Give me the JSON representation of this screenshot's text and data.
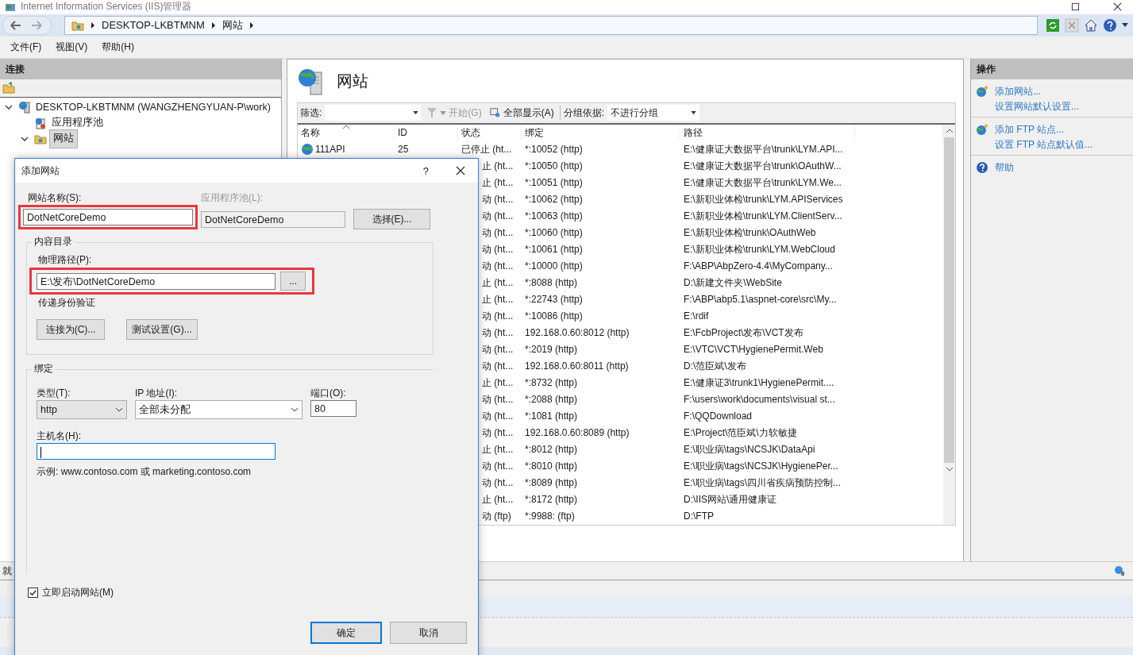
{
  "window": {
    "title": "Internet Information Services (IIS)管理器"
  },
  "address": {
    "crumbs": [
      "DESKTOP-LKBTMNM",
      "网站"
    ]
  },
  "menu": [
    "文件(F)",
    "视图(V)",
    "帮助(H)"
  ],
  "connections": {
    "title": "连接",
    "tree": [
      {
        "label": "DESKTOP-LKBTMNM (WANGZHENGYUAN-P\\work)",
        "kind": "server",
        "expanded": true,
        "selected": false,
        "children": [
          {
            "label": "应用程序池",
            "kind": "pool",
            "selected": false
          },
          {
            "label": "网站",
            "kind": "sites",
            "expanded": true,
            "selected": true
          }
        ]
      }
    ]
  },
  "content": {
    "title": "网站",
    "filter": {
      "label": "筛选:"
    },
    "start": {
      "label": "开始(G)",
      "disabled": true
    },
    "show_all": "全部显示(A)",
    "group_by": {
      "label": "分组依据:",
      "value": "不进行分组"
    },
    "columns": [
      "名称",
      "ID",
      "状态",
      "绑定",
      "路径"
    ],
    "rows": [
      {
        "name": "111API",
        "id": "25",
        "status": "已停止 (ht...",
        "binding": "*:10052 (http)",
        "path": "E:\\健康证大数据平台\\trunk\\LYM.API..."
      },
      {
        "status": "止 (ht...",
        "binding": "*:10050 (http)",
        "path": "E:\\健康证大数据平台\\trunk\\OAuthW..."
      },
      {
        "status": "止 (ht...",
        "binding": "*:10051 (http)",
        "path": "E:\\健康证大数据平台\\trunk\\LYM.We..."
      },
      {
        "status": "动 (ht...",
        "binding": "*:10062 (http)",
        "path": "E:\\新职业体检\\trunk\\LYM.APIServices"
      },
      {
        "status": "动 (ht...",
        "binding": "*:10063 (http)",
        "path": "E:\\新职业体检\\trunk\\LYM.ClientServ..."
      },
      {
        "status": "动 (ht...",
        "binding": "*:10060 (http)",
        "path": "E:\\新职业体检\\trunk\\OAuthWeb"
      },
      {
        "status": "动 (ht...",
        "binding": "*:10061 (http)",
        "path": "E:\\新职业体检\\trunk\\LYM.WebCloud"
      },
      {
        "status": "动 (ht...",
        "binding": "*:10000 (http)",
        "path": "F:\\ABP\\AbpZero-4.4\\MyCompany..."
      },
      {
        "status": "止 (ht...",
        "binding": "*:8088 (http)",
        "path": "D:\\新建文件夹\\WebSite"
      },
      {
        "status": "止 (ht...",
        "binding": "*:22743 (http)",
        "path": "F:\\ABP\\abp5.1\\aspnet-core\\src\\My..."
      },
      {
        "status": "动 (ht...",
        "binding": "*:10086 (http)",
        "path": "E:\\rdif"
      },
      {
        "status": "动 (ht...",
        "binding": "192.168.0.60:8012 (http)",
        "path": "E:\\FcbProject\\发布\\VCT发布"
      },
      {
        "status": "动 (ht...",
        "binding": "*:2019 (http)",
        "path": "E:\\VTC\\VCT\\HygienePermit.Web"
      },
      {
        "status": "动 (ht...",
        "binding": "192.168.0.60:8011 (http)",
        "path": "D:\\范臣斌\\发布"
      },
      {
        "status": "止 (ht...",
        "binding": "*:8732 (http)",
        "path": "E:\\健康证3\\trunk1\\HygienePermit...."
      },
      {
        "status": "动 (ht...",
        "binding": "*:2088 (http)",
        "path": "F:\\users\\work\\documents\\visual st..."
      },
      {
        "status": "动 (ht...",
        "binding": "*:1081 (http)",
        "path": "F:\\QQDownload"
      },
      {
        "status": "动 (ht...",
        "binding": "192.168.0.60:8089 (http)",
        "path": "E:\\Project\\范臣斌\\力软敏捷"
      },
      {
        "status": "止 (ht...",
        "binding": "*:8012 (http)",
        "path": "E:\\职业病\\tags\\NCSJK\\DataApi"
      },
      {
        "status": "动 (ht...",
        "binding": "*:8010 (http)",
        "path": "E:\\职业病\\tags\\NCSJK\\HygienePer..."
      },
      {
        "status": "动 (ht...",
        "binding": "*:8089 (http)",
        "path": "E:\\职业病\\tags\\四川省疾病预防控制..."
      },
      {
        "status": "止 (ht...",
        "binding": "*:8172 (http)",
        "path": "D:\\IIS网站\\通用健康证"
      },
      {
        "status": "动 (ftp)",
        "binding": "*:9988: (ftp)",
        "path": "D:\\FTP"
      }
    ]
  },
  "actions": {
    "title": "操作",
    "groups": [
      [
        {
          "label": "添加网站...",
          "kind": "add"
        },
        {
          "label": "设置网站默认设置...",
          "kind": "plain"
        }
      ],
      [
        {
          "label": "添加 FTP 站点...",
          "kind": "add"
        },
        {
          "label": "设置 FTP 站点默认值...",
          "kind": "plain"
        }
      ],
      [
        {
          "label": "帮助",
          "kind": "help"
        }
      ]
    ]
  },
  "status_bar": {
    "text": "就"
  },
  "dialog": {
    "title": "添加网站",
    "help": "?",
    "site_name": {
      "label": "网站名称(S):",
      "value": "DotNetCoreDemo",
      "highlighted": true
    },
    "app_pool": {
      "label": "应用程序池(L):",
      "value": "DotNetCoreDemo",
      "disabled": true
    },
    "select_button": "选择(E)...",
    "content_group": "内容目录",
    "physical_path": {
      "label": "物理路径(P):",
      "value": "E:\\发布\\DotNetCoreDemo",
      "highlighted": true
    },
    "browse_button": "...",
    "auth_label": "传递身份验证",
    "connect_button": "连接为(C)...",
    "test_button": "测试设置(G)...",
    "binding_group": "绑定",
    "type": {
      "label": "类型(T):",
      "value": "http"
    },
    "ip": {
      "label": "IP 地址(I):",
      "value": "全部未分配"
    },
    "port": {
      "label": "端口(O):",
      "value": "80"
    },
    "host": {
      "label": "主机名(H):",
      "focused": true
    },
    "example": "示例: www.contoso.com 或 marketing.contoso.com",
    "start_now": {
      "label": "立即启动网站(M)",
      "checked": true
    },
    "ok_button": "确定",
    "cancel_button": "取消"
  }
}
